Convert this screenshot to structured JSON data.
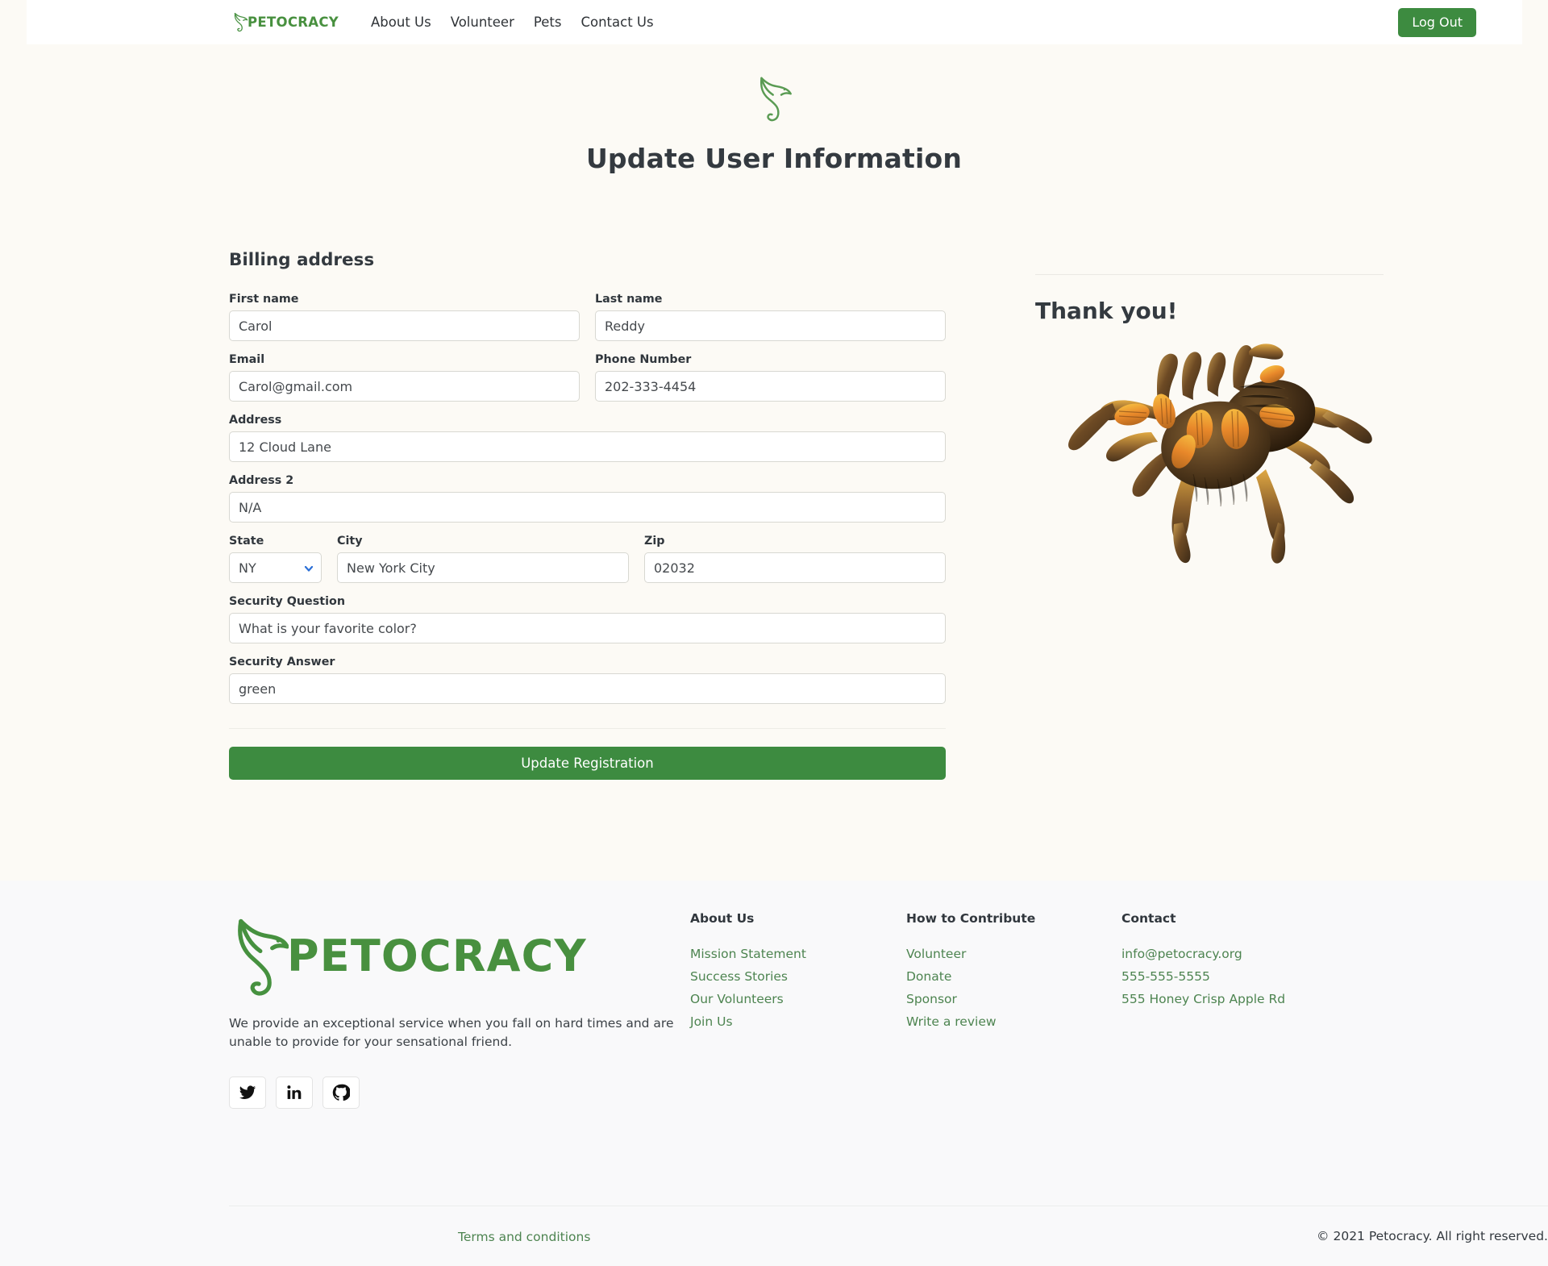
{
  "brand": {
    "name": "PETOCRACY",
    "logo_icon": "bird-logo-icon",
    "color": "#48903f"
  },
  "navbar": {
    "links": [
      {
        "label": "About Us",
        "name": "nav-link-about-us"
      },
      {
        "label": "Volunteer",
        "name": "nav-link-volunteer"
      },
      {
        "label": "Pets",
        "name": "nav-link-pets"
      },
      {
        "label": "Contact Us",
        "name": "nav-link-contact-us"
      }
    ],
    "logout_label": "Log Out"
  },
  "header": {
    "title": "Update User Information",
    "bird_icon": "bird-logo-icon"
  },
  "form": {
    "section_title": "Billing address",
    "first_name": {
      "label": "First name",
      "value": "Carol"
    },
    "last_name": {
      "label": "Last name",
      "value": "Reddy"
    },
    "email": {
      "label": "Email",
      "value": "Carol@gmail.com"
    },
    "phone": {
      "label": "Phone Number",
      "value": "202-333-4454"
    },
    "address": {
      "label": "Address",
      "value": "12 Cloud Lane"
    },
    "address2": {
      "label": "Address 2",
      "value": "N/A"
    },
    "state": {
      "label": "State",
      "value": "NY",
      "options": [
        "NY"
      ],
      "caret_icon": "chevron-down-icon"
    },
    "city": {
      "label": "City",
      "value": "New York City"
    },
    "zip": {
      "label": "Zip",
      "value": "02032"
    },
    "security_question": {
      "label": "Security Question",
      "value": "What is your favorite color?"
    },
    "security_answer": {
      "label": "Security Answer",
      "value": "green"
    },
    "submit_label": "Update Registration",
    "submit_color": "#3d8b40"
  },
  "side": {
    "thanks_title": "Thank you!",
    "image_name": "tarantula-photo"
  },
  "footer": {
    "brand_name": "PETOCRACY",
    "description": "We provide an exceptional service when you fall on hard times and are unable to provide for your sensational friend.",
    "socials": [
      {
        "name": "twitter-icon",
        "label": "Twitter"
      },
      {
        "name": "linkedin-icon",
        "label": "LinkedIn"
      },
      {
        "name": "github-icon",
        "label": "GitHub"
      }
    ],
    "columns": [
      {
        "title": "About Us",
        "links": [
          "Mission Statement",
          "Success Stories",
          "Our Volunteers",
          "Join Us"
        ]
      },
      {
        "title": "How to Contribute",
        "links": [
          "Volunteer",
          "Donate",
          "Sponsor",
          "Write a review"
        ]
      },
      {
        "title": "Contact",
        "links": [
          "info@petocracy.org",
          "555-555-5555",
          "555 Honey Crisp Apple Rd"
        ]
      }
    ],
    "terms_label": "Terms and conditions",
    "copyright": "© 2021 Petocracy. All right reserved."
  }
}
